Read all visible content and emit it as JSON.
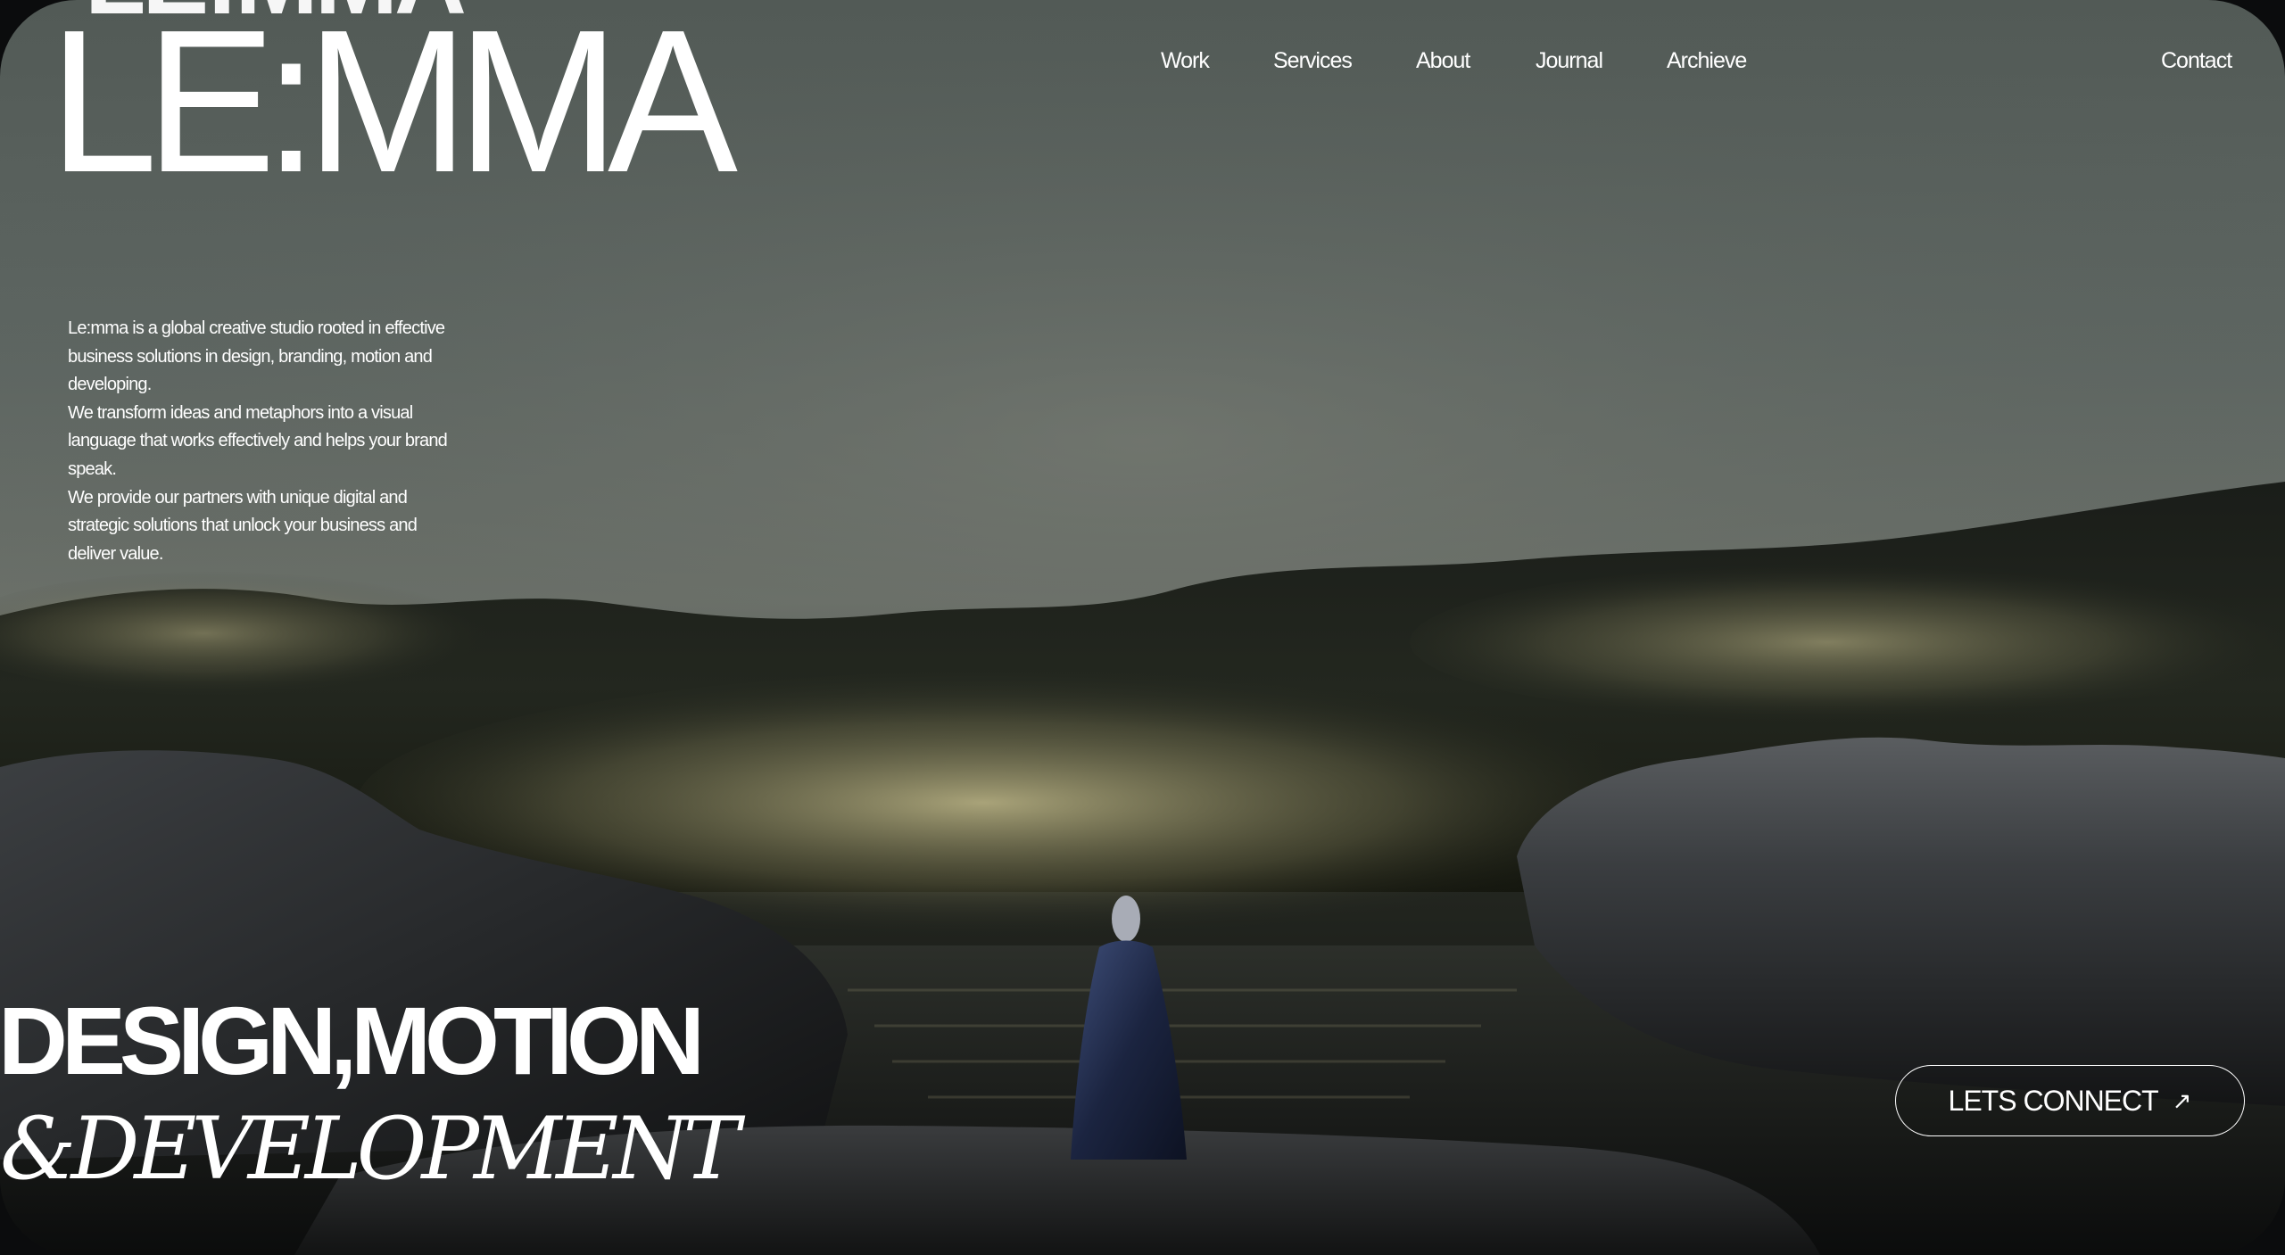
{
  "brand": {
    "logo": "LE:MMA",
    "ghost_logo": "LE:MMA"
  },
  "nav": {
    "items": [
      {
        "label": "Work"
      },
      {
        "label": "Services"
      },
      {
        "label": "About"
      },
      {
        "label": "Journal"
      },
      {
        "label": "Archieve"
      }
    ],
    "contact": "Contact"
  },
  "intro": {
    "paragraphs": [
      "Le:mma is a global creative studio rooted in effective business solutions in design, branding, motion and developing.",
      "We transform ideas and metaphors into a visual language that works effectively and helps your brand speak.",
      "We provide our partners with unique digital and strategic solutions that unlock your business and deliver value."
    ]
  },
  "headline": {
    "line1": "DESIGN,MOTION",
    "line2": "&DEVELOPMENT"
  },
  "cta": {
    "label": "LETS CONNECT",
    "icon": "arrow-up-right-icon",
    "glyph": "↗"
  },
  "colors": {
    "text": "#ffffff",
    "sky": "#5e6662",
    "rock": "#2d2f31",
    "flowers_warm": "#d8cf9a",
    "flowers_cool": "#5a66c8"
  }
}
